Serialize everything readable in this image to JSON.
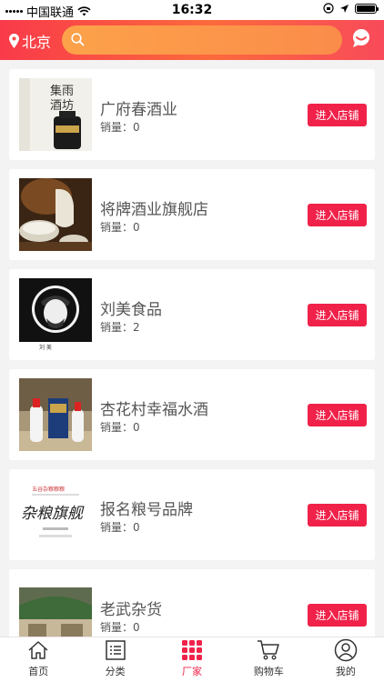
{
  "status_bar": {
    "carrier": "中国联通",
    "time": "16:32"
  },
  "header": {
    "location": "北京"
  },
  "colors": {
    "accent": "#f0224a",
    "header_start": "#f93a4a",
    "header_end": "#fb6a3c"
  },
  "shops": [
    {
      "name": "广府春酒业",
      "sales_label": "销量：",
      "sales": "0",
      "button": "进入店铺"
    },
    {
      "name": "将牌酒业旗舰店",
      "sales_label": "销量：",
      "sales": "0",
      "button": "进入店铺"
    },
    {
      "name": "刘美食品",
      "sales_label": "销量：",
      "sales": "2",
      "button": "进入店铺"
    },
    {
      "name": "杏花村幸福水酒",
      "sales_label": "销量：",
      "sales": "0",
      "button": "进入店铺"
    },
    {
      "name": "报名粮号品牌",
      "sales_label": "销量：",
      "sales": "0",
      "button": "进入店铺"
    },
    {
      "name": "老武杂货",
      "sales_label": "销量：",
      "sales": "0",
      "button": "进入店铺"
    }
  ],
  "thumb_text": {
    "shop0_art": "集雨酒坊",
    "shop4_top": "五谷杂粮粮粮",
    "shop4_art": "杂粮旗舰"
  },
  "tabs": [
    {
      "label": "首页",
      "icon": "home-icon"
    },
    {
      "label": "分类",
      "icon": "list-icon"
    },
    {
      "label": "厂家",
      "icon": "grid-icon"
    },
    {
      "label": "购物车",
      "icon": "cart-icon"
    },
    {
      "label": "我的",
      "icon": "user-icon"
    }
  ],
  "active_tab": "厂家"
}
